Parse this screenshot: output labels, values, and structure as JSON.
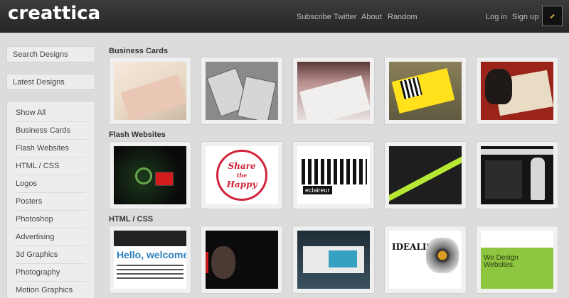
{
  "header": {
    "logo": "creattica",
    "nav": [
      "Subscribe",
      "Twitter",
      "About",
      "Random"
    ],
    "login": "Log in",
    "signup": "Sign up"
  },
  "sidebar": {
    "search": "Search Designs",
    "latest": "Latest Designs",
    "categories": [
      "Show All",
      "Business Cards",
      "Flash Websites",
      "HTML / CSS",
      "Logos",
      "Posters",
      "Photoshop",
      "Advertising",
      "3d Graphics",
      "Photography",
      "Motion Graphics"
    ]
  },
  "sections": [
    {
      "title": "Business Cards"
    },
    {
      "title": "Flash Websites"
    },
    {
      "title": "HTML / CSS"
    }
  ],
  "thumb_text": {
    "share_1": "Share",
    "share_2": "the",
    "share_3": "Happy",
    "eclaireur": "eclaireur",
    "hello": "Hello, welcome",
    "idealism": "IDEALISM",
    "we_design": "We Design Websites."
  },
  "colors": {
    "header_bg": "#262626",
    "page_bg": "#dcdcdc",
    "accent_red": "#d0243a",
    "accent_green": "#8ec63f"
  }
}
